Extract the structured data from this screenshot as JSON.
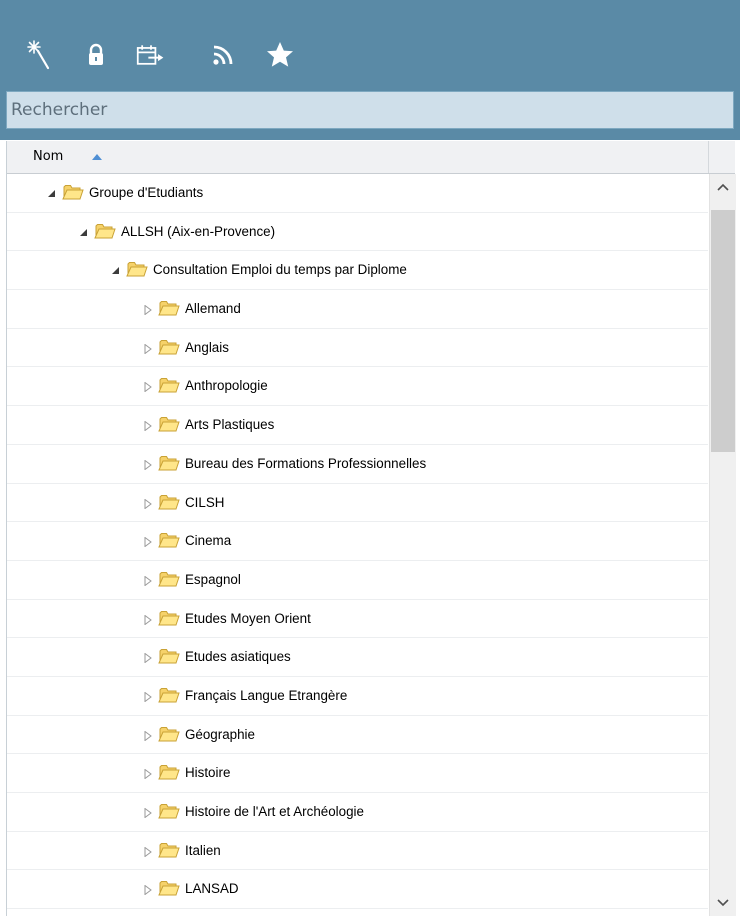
{
  "toolbar": {
    "icons": [
      "magic-wand-icon",
      "lock-icon",
      "calendar-export-icon",
      "rss-icon",
      "star-icon"
    ],
    "background": "#5a8aa6"
  },
  "search": {
    "placeholder": "Rechercher",
    "value": ""
  },
  "grid": {
    "column_header": "Nom",
    "sort_direction": "ascending",
    "rows": [
      {
        "level": 0,
        "expanded": true,
        "label": "Groupe d'Etudiants"
      },
      {
        "level": 1,
        "expanded": true,
        "label": "ALLSH (Aix-en-Provence)"
      },
      {
        "level": 2,
        "expanded": true,
        "label": "Consultation Emploi du temps par Diplome"
      },
      {
        "level": 3,
        "expanded": false,
        "label": "Allemand"
      },
      {
        "level": 3,
        "expanded": false,
        "label": "Anglais"
      },
      {
        "level": 3,
        "expanded": false,
        "label": "Anthropologie"
      },
      {
        "level": 3,
        "expanded": false,
        "label": "Arts Plastiques"
      },
      {
        "level": 3,
        "expanded": false,
        "label": "Bureau des Formations Professionnelles"
      },
      {
        "level": 3,
        "expanded": false,
        "label": "CILSH"
      },
      {
        "level": 3,
        "expanded": false,
        "label": "Cinema"
      },
      {
        "level": 3,
        "expanded": false,
        "label": "Espagnol"
      },
      {
        "level": 3,
        "expanded": false,
        "label": "Etudes Moyen Orient"
      },
      {
        "level": 3,
        "expanded": false,
        "label": "Etudes asiatiques"
      },
      {
        "level": 3,
        "expanded": false,
        "label": "Français Langue Etrangère"
      },
      {
        "level": 3,
        "expanded": false,
        "label": "Géographie"
      },
      {
        "level": 3,
        "expanded": false,
        "label": "Histoire"
      },
      {
        "level": 3,
        "expanded": false,
        "label": "Histoire de l'Art et Archéologie"
      },
      {
        "level": 3,
        "expanded": false,
        "label": "Italien"
      },
      {
        "level": 3,
        "expanded": false,
        "label": "LANSAD"
      }
    ]
  }
}
